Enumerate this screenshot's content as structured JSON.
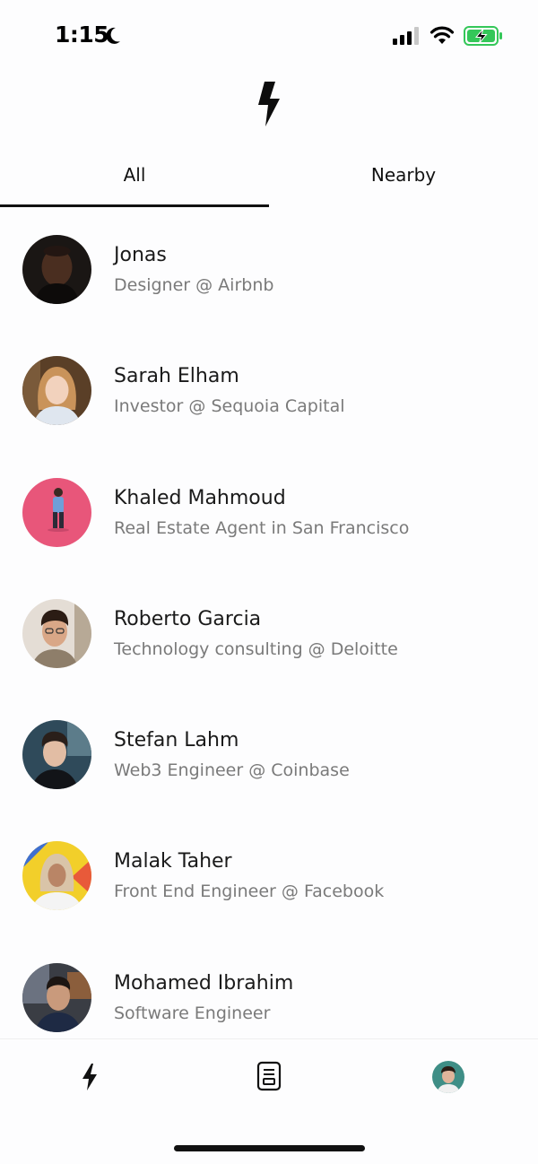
{
  "status_bar": {
    "time": "1:15",
    "icons": [
      "moon-icon",
      "cellular-signal-icon",
      "wifi-icon",
      "battery-charging-icon"
    ],
    "battery_color": "#34c759"
  },
  "header": {
    "logo_icon": "lightning-bolt-icon"
  },
  "tabs": [
    {
      "label": "All",
      "selected": true
    },
    {
      "label": "Nearby",
      "selected": false
    }
  ],
  "people": [
    {
      "name": "Jonas",
      "subtitle": "Designer @ Airbnb",
      "avatar_bg": "#2a2420"
    },
    {
      "name": "Sarah Elham",
      "subtitle": "Investor @ Sequoia Capital",
      "avatar_bg": "#6b4a2e"
    },
    {
      "name": "Khaled Mahmoud",
      "subtitle": "Real Estate Agent in San Francisco",
      "avatar_bg": "#e8567a"
    },
    {
      "name": "Roberto Garcia",
      "subtitle": "Technology consulting @ Deloitte",
      "avatar_bg": "#d8cfc6"
    },
    {
      "name": "Stefan Lahm",
      "subtitle": "Web3 Engineer @ Coinbase",
      "avatar_bg": "#2f4a5a"
    },
    {
      "name": "Malak Taher",
      "subtitle": "Front End Engineer @ Facebook",
      "avatar_bg": "#f2cf2a"
    },
    {
      "name": "Mohamed Ibrahim",
      "subtitle": "Software Engineer",
      "avatar_bg": "#3a3d44"
    }
  ],
  "bottom_nav": {
    "items": [
      {
        "icon": "lightning-bolt-icon"
      },
      {
        "icon": "document-icon"
      },
      {
        "icon": "profile-avatar"
      }
    ]
  }
}
